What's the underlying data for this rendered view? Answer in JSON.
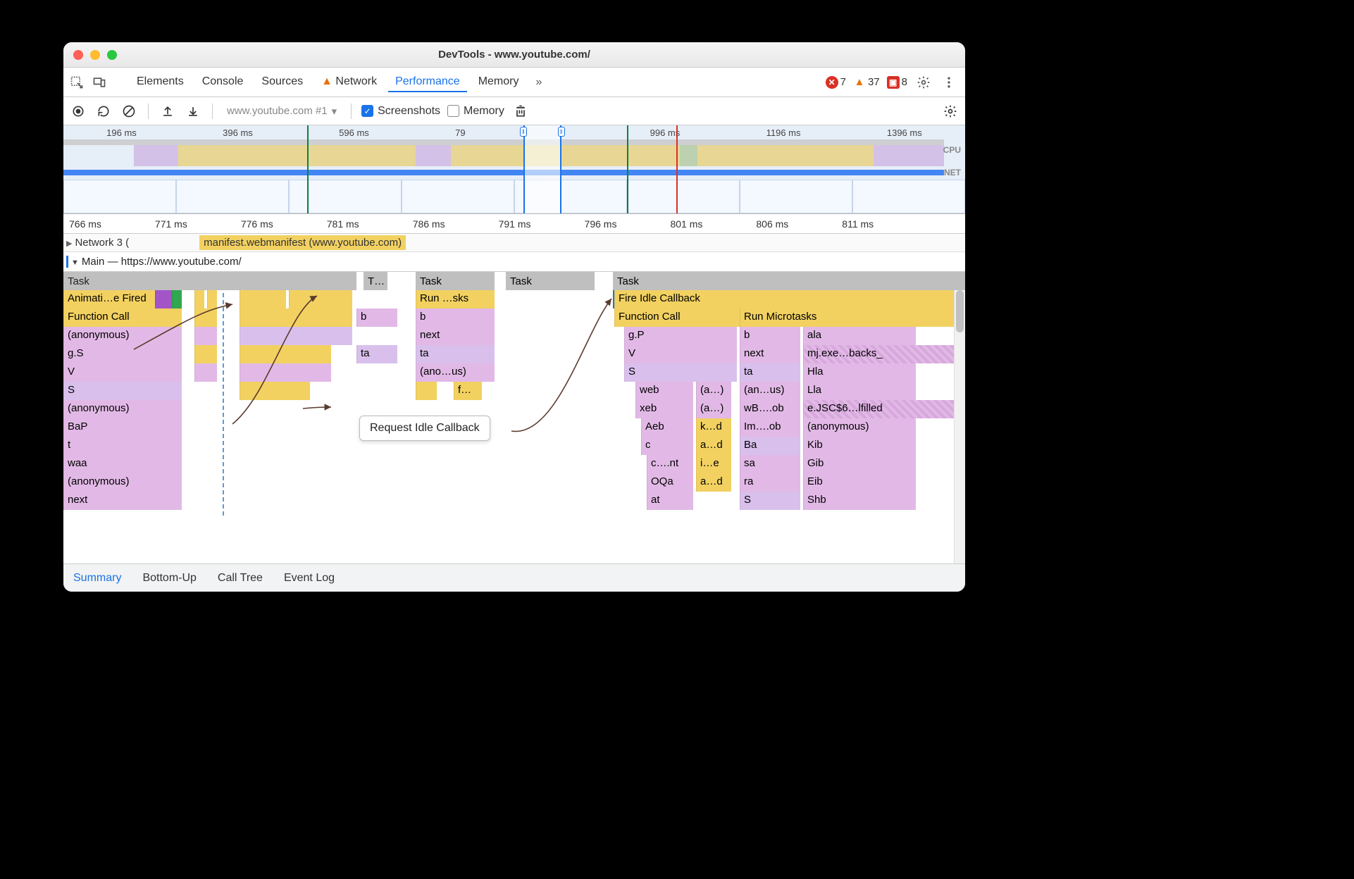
{
  "window_title": "DevTools - www.youtube.com/",
  "tabs": [
    "Elements",
    "Console",
    "Sources",
    "Network",
    "Performance",
    "Memory"
  ],
  "active_tab": "Performance",
  "counts": {
    "errors": "7",
    "warnings": "37",
    "issues": "8"
  },
  "controlbar": {
    "recording_label": "www.youtube.com #1",
    "screenshots": "Screenshots",
    "memory": "Memory"
  },
  "overview_ticks": [
    "196 ms",
    "396 ms",
    "596 ms",
    "79",
    "996 ms",
    "1196 ms",
    "1396 ms"
  ],
  "overview_labels": {
    "cpu": "CPU",
    "net": "NET"
  },
  "ruler_ticks": [
    "766 ms",
    "771 ms",
    "776 ms",
    "781 ms",
    "786 ms",
    "791 ms",
    "796 ms",
    "801 ms",
    "806 ms",
    "811 ms"
  ],
  "network_row": {
    "title": "Network  3 (",
    "item": "manifest.webmanifest (www.youtube.com)"
  },
  "main_title": "Main — https://www.youtube.com/",
  "taskrow": {
    "left": "Task",
    "t": "T…",
    "mid": "Task",
    "mid2": "Task",
    "right": "Task"
  },
  "left_stack": [
    "Animati…e Fired",
    "Function Call",
    "(anonymous)",
    "g.S",
    "V",
    "S",
    "(anonymous)",
    "BaP",
    "t",
    "waa",
    "(anonymous)",
    "next"
  ],
  "mid_stack": {
    "r1": "Run …sks",
    "r2": "b",
    "r3": "next",
    "r4": "ta",
    "r5": "(ano…us)",
    "r6": "f…"
  },
  "mid2": {
    "r2": "b",
    "r4": "ta"
  },
  "right_headline": "Fire Idle Callback",
  "right_row2": {
    "a": "Function Call",
    "b": "Run Microtasks"
  },
  "right_col_a": [
    "g.P",
    "V",
    "S"
  ],
  "right_sub_a": [
    "web",
    "xeb",
    "Aeb",
    "c",
    "c….nt",
    "OQa",
    "at"
  ],
  "right_sub_b": [
    "(a…)",
    "(a…)",
    "k…d",
    "a…d",
    "i…e",
    "a…d"
  ],
  "right_col_b": [
    "b",
    "next",
    "ta",
    "(an…us)",
    "wB….ob",
    "Im….ob",
    "Ba",
    "sa",
    "ra",
    "S"
  ],
  "right_col_c": [
    "ala",
    "mj.exe…backs_",
    "Hla",
    "Lla",
    "e.JSC$6…lfilled",
    "(anonymous)",
    "Kib",
    "Gib",
    "Eib",
    "Shb"
  ],
  "callout": "Request Idle Callback",
  "bottom_tabs": [
    "Summary",
    "Bottom-Up",
    "Call Tree",
    "Event Log"
  ],
  "active_bottom_tab": "Summary"
}
